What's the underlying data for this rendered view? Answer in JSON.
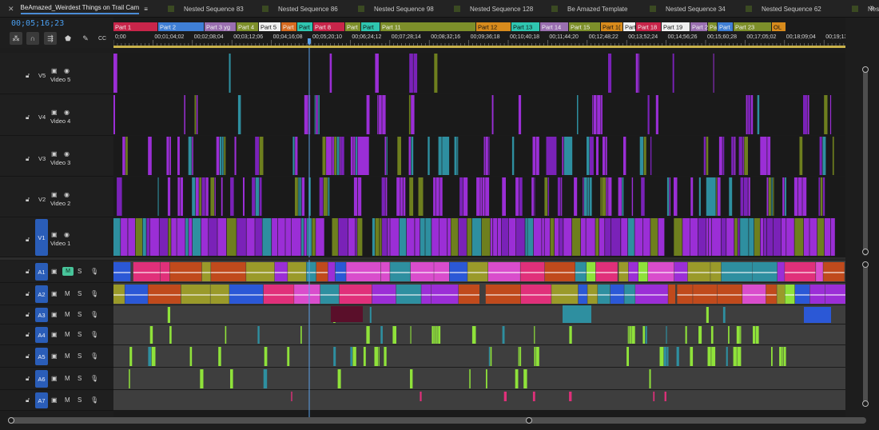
{
  "tabs": [
    {
      "label": "BeAmazed_Weirdest Things on Trail Cam",
      "active": true
    },
    {
      "label": "Nested Sequence 83"
    },
    {
      "label": "Nested Sequence 86"
    },
    {
      "label": "Nested Sequence 98"
    },
    {
      "label": "Nested Sequence 128"
    },
    {
      "label": "Be Amazed Template"
    },
    {
      "label": "Nested Sequence 34"
    },
    {
      "label": "Nested Sequence 62"
    },
    {
      "label": "Nest"
    }
  ],
  "timecode": "00;05;16;23",
  "ruler_ticks": [
    "0;00",
    "00;01;04;02",
    "00;02;08;04",
    "00;03;12;06",
    "00;04;16;08",
    "00;05;20;10",
    "00;06;24;12",
    "00;07;28;14",
    "00;08;32;16",
    "00;09;36;18",
    "00;10;40;18",
    "00;11;44;20",
    "00;12;48;22",
    "00;13;52;24",
    "00;14;56;26",
    "00;15;60;28",
    "00;17;05;02",
    "00;18;09;04",
    "00;19;13;06",
    "00;2"
  ],
  "markers": [
    {
      "label": "Part 1",
      "color": "#c8254a"
    },
    {
      "label": "Part 2",
      "color": "#3f7fd6"
    },
    {
      "label": "Part 3 yg",
      "color": "#9a6fb0"
    },
    {
      "label": "Part 4",
      "color": "#7d8f2a"
    },
    {
      "label": "Part 5",
      "color": "#f0f0f0"
    },
    {
      "label": "Part",
      "color": "#d76a1f"
    },
    {
      "label": "Part",
      "color": "#2fc6b0"
    },
    {
      "label": "Part 8",
      "color": "#c8254a"
    },
    {
      "label": "Part",
      "color": "#7d8f2a"
    },
    {
      "label": "Part",
      "color": "#2fc6b0"
    },
    {
      "label": "Part 11",
      "color": "#7d8f2a"
    },
    {
      "label": "Part 12",
      "color": "#d88b1c"
    },
    {
      "label": "Part 13",
      "color": "#2fc6b0"
    },
    {
      "label": "Part 14",
      "color": "#9a6fb0"
    },
    {
      "label": "Part 15",
      "color": "#7d8f2a"
    },
    {
      "label": "Part 1(",
      "color": "#d88b1c"
    },
    {
      "label": "Part",
      "color": "#f0f0f0"
    },
    {
      "label": "Part 18",
      "color": "#c8254a"
    },
    {
      "label": "Part 19",
      "color": "#f0f0f0"
    },
    {
      "label": "Part 2",
      "color": "#9a6fb0"
    },
    {
      "label": "Pa",
      "color": "#7d8f2a"
    },
    {
      "label": "Part",
      "color": "#3f7fd6"
    },
    {
      "label": "Part 23",
      "color": "#7d8f2a"
    },
    {
      "label": "OL",
      "color": "#d88b1c"
    }
  ],
  "video_tracks": [
    {
      "id": "V5",
      "name": "Video 5",
      "targeted": false
    },
    {
      "id": "V4",
      "name": "Video 4",
      "targeted": false
    },
    {
      "id": "V3",
      "name": "Video 3",
      "targeted": false
    },
    {
      "id": "V2",
      "name": "Video 2",
      "targeted": false
    },
    {
      "id": "V1",
      "name": "Video 1",
      "targeted": true
    }
  ],
  "audio_tracks": [
    {
      "id": "A1",
      "targeted": true,
      "mute_on": true
    },
    {
      "id": "A2",
      "targeted": true,
      "mute_on": false
    },
    {
      "id": "A3",
      "targeted": true,
      "mute_on": false
    },
    {
      "id": "A4",
      "targeted": true,
      "mute_on": false
    },
    {
      "id": "A5",
      "targeted": true,
      "mute_on": false
    },
    {
      "id": "A6",
      "targeted": true,
      "mute_on": false
    },
    {
      "id": "A7",
      "targeted": true,
      "mute_on": false
    }
  ],
  "audio_buttons": {
    "mute": "M",
    "solo": "S"
  },
  "colors": {
    "accent": "#4a9ff0",
    "playhead": "#5aa0e8",
    "target_blue": "#2a5db8",
    "mute_green": "#48c49a",
    "clip_purple": "#9b2ed6",
    "clip_teal": "#2e8fa0",
    "clip_olive": "#6e7f1e",
    "clip_green": "#8fe23a",
    "clip_pink": "#e0307a"
  },
  "icons": {
    "tab_close": "close-icon",
    "tab_menu": "menu-icon",
    "overflow": "double-chevron-right-icon",
    "lock": "lock-icon",
    "toggle_sync": "film-icon",
    "visibility": "eye-icon",
    "voiceover": "microphone-icon"
  }
}
